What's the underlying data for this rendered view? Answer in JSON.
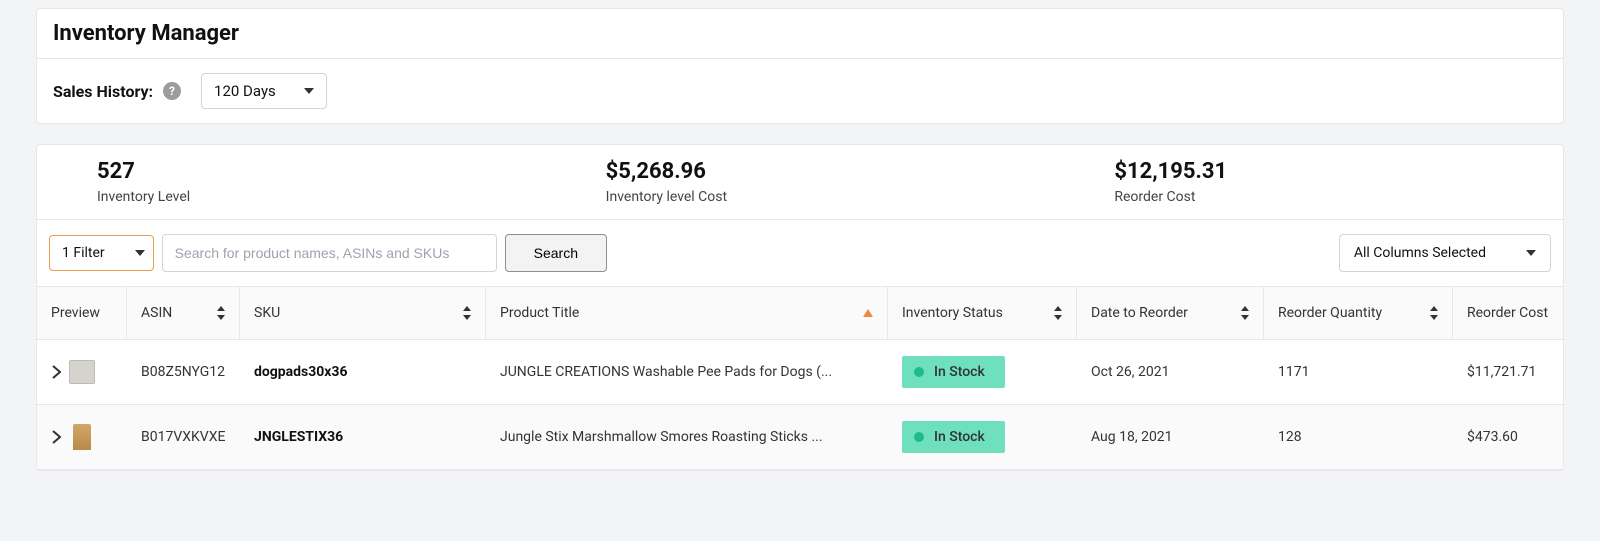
{
  "header": {
    "title": "Inventory Manager",
    "sales_history_label": "Sales History:",
    "sales_history_value": "120 Days"
  },
  "stats": {
    "inventory_level": {
      "value": "527",
      "label": "Inventory Level"
    },
    "inventory_cost": {
      "value": "$5,268.96",
      "label": "Inventory level Cost"
    },
    "reorder_cost": {
      "value": "$12,195.31",
      "label": "Reorder Cost"
    }
  },
  "filters": {
    "filter_button": "1 Filter",
    "search_placeholder": "Search for product names, ASINs and SKUs",
    "search_button": "Search",
    "columns_selected": "All Columns Selected"
  },
  "columns": {
    "preview": "Preview",
    "asin": "ASIN",
    "sku": "SKU",
    "title": "Product Title",
    "status": "Inventory Status",
    "date": "Date to Reorder",
    "qty": "Reorder Quantity",
    "cost": "Reorder Cost"
  },
  "rows": [
    {
      "asin": "B08Z5NYG12",
      "sku": "dogpads30x36",
      "title": "JUNGLE CREATIONS Washable Pee Pads for Dogs (...",
      "status": "In Stock",
      "date": "Oct 26, 2021",
      "qty": "1171",
      "cost": "$11,721.71"
    },
    {
      "asin": "B017VXKVXE",
      "sku": "JNGLESTIX36",
      "title": "Jungle Stix Marshmallow Smores Roasting Sticks ...",
      "status": "In Stock",
      "date": "Aug 18, 2021",
      "qty": "128",
      "cost": "$473.60"
    }
  ]
}
